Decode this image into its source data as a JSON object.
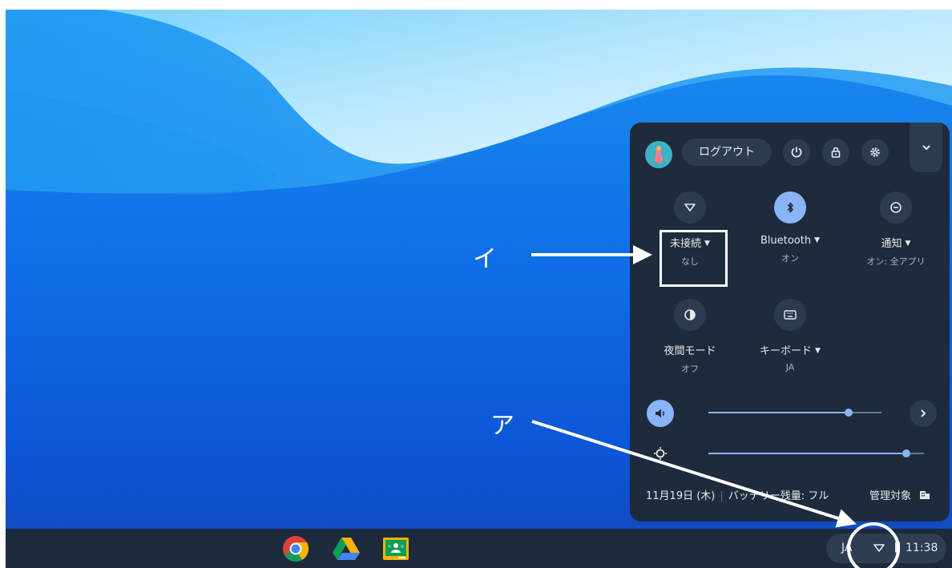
{
  "quick_settings": {
    "logout_label": "ログアウト",
    "tiles": [
      {
        "label": "未接続",
        "sublabel": "なし",
        "has_dropdown": true,
        "icon": "wifi-icon",
        "active": false
      },
      {
        "label": "Bluetooth",
        "sublabel": "オン",
        "has_dropdown": true,
        "icon": "bluetooth-icon",
        "active": true
      },
      {
        "label": "通知",
        "sublabel": "オン: 全アプリ",
        "has_dropdown": true,
        "icon": "notification-icon",
        "active": false
      },
      {
        "label": "夜間モード",
        "sublabel": "オフ",
        "has_dropdown": false,
        "icon": "night-light-icon",
        "active": false
      },
      {
        "label": "キーボード",
        "sublabel": "JA",
        "has_dropdown": true,
        "icon": "keyboard-icon",
        "active": false
      }
    ],
    "volume_level": 0.81,
    "brightness_level": 0.92,
    "date": "11月19日 (木)",
    "battery": "バッテリー残量: フル",
    "managed": "管理対象"
  },
  "shelf": {
    "apps": [
      "chrome-icon",
      "google-drive-icon",
      "google-classroom-icon"
    ],
    "status": {
      "ime": "JA",
      "time": "11:38"
    }
  },
  "annotations": {
    "label_a": "ア",
    "label_i": "イ"
  },
  "colors": {
    "accent": "#8ab4f8",
    "panel": "#1e2b3c",
    "shelf": "#1c2a3c"
  }
}
